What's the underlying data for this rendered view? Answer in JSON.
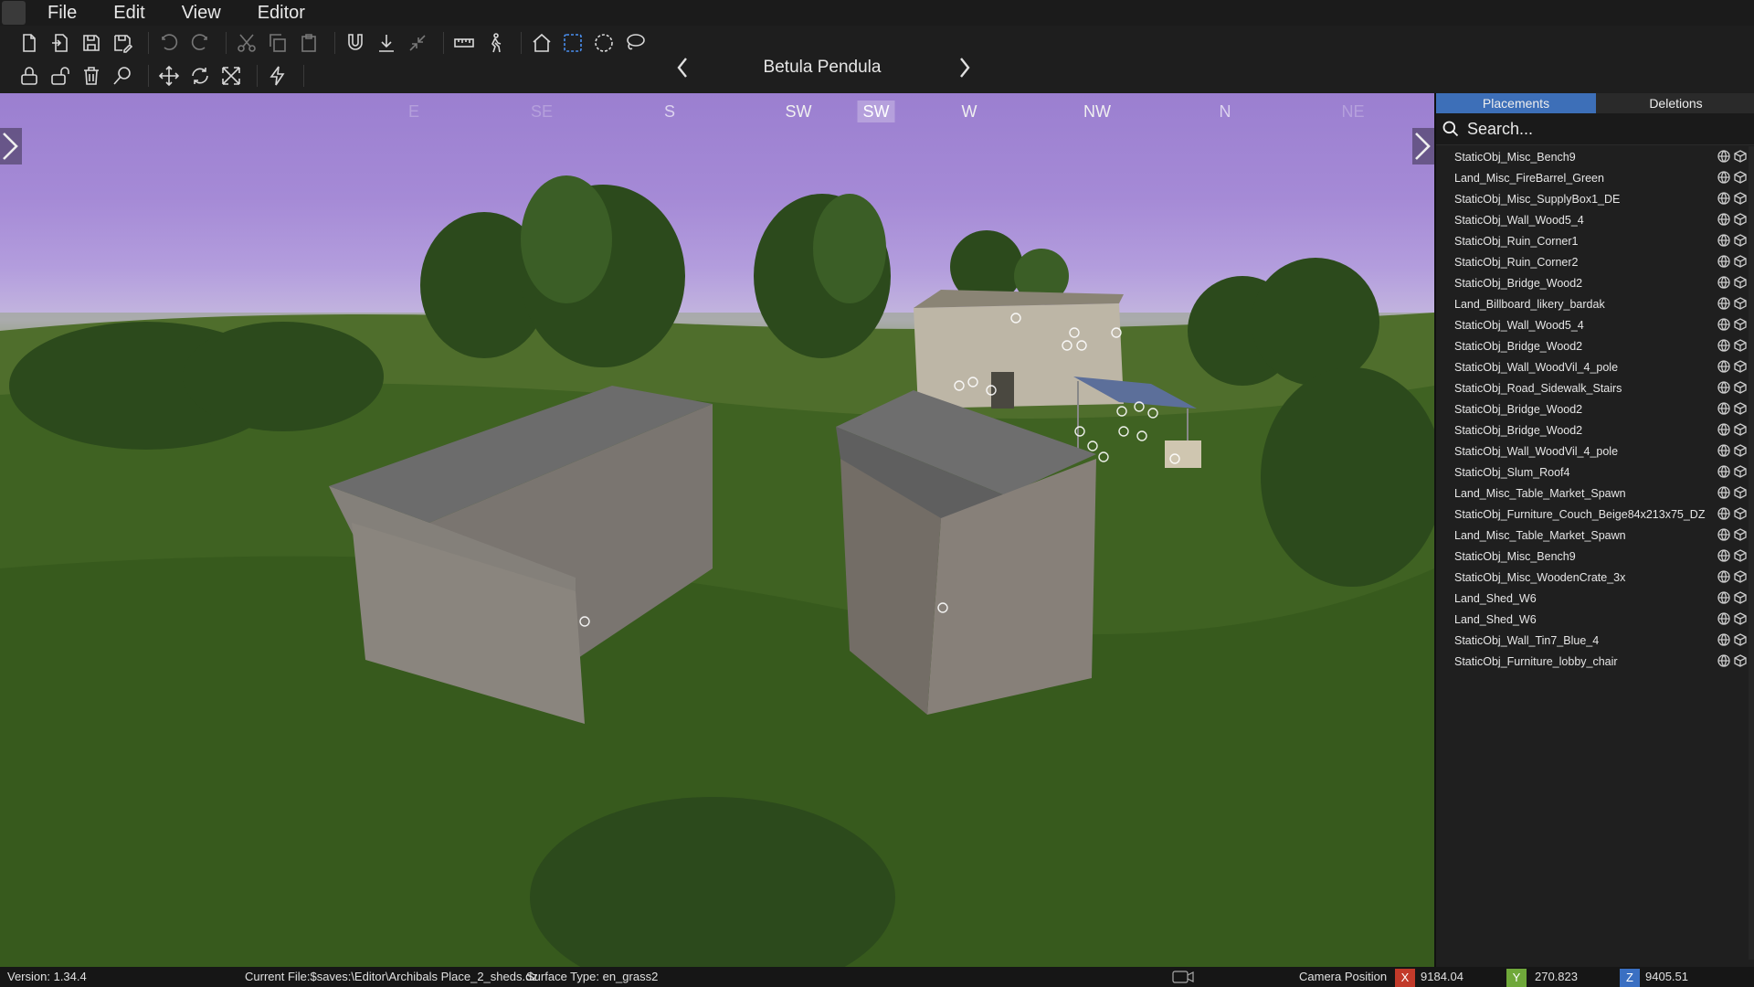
{
  "menubar": {
    "logo_label": "Editor",
    "items": [
      "File",
      "Edit",
      "View",
      "Editor"
    ]
  },
  "toolbar": {
    "brush_name": "Betula Pendula"
  },
  "compass": {
    "labels": [
      "E",
      "SE",
      "S",
      "SW",
      "SW",
      "W",
      "NW",
      "N",
      "NE"
    ]
  },
  "panel": {
    "tabs": [
      "Placements",
      "Deletions"
    ],
    "search_placeholder": "Search...",
    "items": [
      "StaticObj_Misc_Bench9",
      "Land_Misc_FireBarrel_Green",
      "StaticObj_Misc_SupplyBox1_DE",
      "StaticObj_Wall_Wood5_4",
      "StaticObj_Ruin_Corner1",
      "StaticObj_Ruin_Corner2",
      "StaticObj_Bridge_Wood2",
      "Land_Billboard_likery_bardak",
      "StaticObj_Wall_Wood5_4",
      "StaticObj_Bridge_Wood2",
      "StaticObj_Wall_WoodVil_4_pole",
      "StaticObj_Road_Sidewalk_Stairs",
      "StaticObj_Bridge_Wood2",
      "StaticObj_Bridge_Wood2",
      "StaticObj_Wall_WoodVil_4_pole",
      "StaticObj_Slum_Roof4",
      "Land_Misc_Table_Market_Spawn",
      "StaticObj_Furniture_Couch_Beige84x213x75_DZ",
      "Land_Misc_Table_Market_Spawn",
      "StaticObj_Misc_Bench9",
      "StaticObj_Misc_WoodenCrate_3x",
      "Land_Shed_W6",
      "Land_Shed_W6",
      "StaticObj_Wall_Tin7_Blue_4",
      "StaticObj_Furniture_lobby_chair"
    ]
  },
  "statusbar": {
    "version": "Version:  1.34.4",
    "current_file": "Current File:$saves:\\Editor\\Archibals Place_2_sheds.dze",
    "surface_type": "Surface Type: en_grass2",
    "camera_label": "Camera Position",
    "x_label": "X",
    "x_value": "9184.04",
    "y_label": "Y",
    "y_value": "270.823",
    "z_label": "Z",
    "z_value": "9405.51"
  },
  "colors": {
    "tab_active": "#3d6fb8",
    "x_badge": "#c23a2a",
    "y_badge": "#6fa83a",
    "z_badge": "#3a6fc2"
  }
}
